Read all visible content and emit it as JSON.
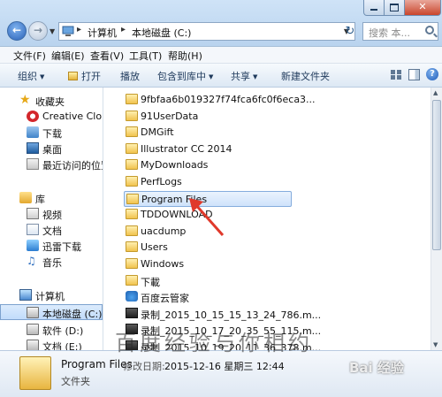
{
  "address": {
    "crumbs": [
      "计算机",
      "本地磁盘 (C:)"
    ],
    "separator": "▸"
  },
  "search": {
    "placeholder": "搜索 本..."
  },
  "menu": [
    "文件(F)",
    "编辑(E)",
    "查看(V)",
    "工具(T)",
    "帮助(H)"
  ],
  "commands": {
    "organize": "组织",
    "open": "打开",
    "play": "播放",
    "include": "包含到库中",
    "share": "共享",
    "new_folder": "新建文件夹"
  },
  "nav": {
    "favorites": "收藏夹",
    "creative_cloud": "Creative Cloud",
    "downloads": "下载",
    "desktop": "桌面",
    "recent": "最近访问的位置",
    "libraries": "库",
    "videos": "视频",
    "documents": "文档",
    "xunlei": "迅雷下载",
    "music": "音乐",
    "computer": "计算机",
    "drive_c": "本地磁盘 (C:)",
    "drive_d": "软件 (D:)",
    "drive_e": "文档 (E:)"
  },
  "files": [
    {
      "name": "9fbfaa6b019327f74fca6fc0f6eca3...",
      "icon": "folder-icon"
    },
    {
      "name": "91UserData",
      "icon": "folder-icon"
    },
    {
      "name": "DMGift",
      "icon": "folder-icon"
    },
    {
      "name": "Illustrator CC 2014",
      "icon": "folder-icon"
    },
    {
      "name": "MyDownloads",
      "icon": "folder-icon"
    },
    {
      "name": "PerfLogs",
      "icon": "folder-icon"
    },
    {
      "name": "Program Files",
      "icon": "folder-icon"
    },
    {
      "name": "TDDOWNLOAD",
      "icon": "folder-icon"
    },
    {
      "name": "uacdump",
      "icon": "folder-icon"
    },
    {
      "name": "Users",
      "icon": "folder-icon"
    },
    {
      "name": "Windows",
      "icon": "folder-icon"
    },
    {
      "name": "下載",
      "icon": "folder-icon"
    },
    {
      "name": "百度云管家",
      "icon": "cloud-icon"
    },
    {
      "name": "录制_2015_10_15_15_13_24_786.m...",
      "icon": "video-file-icon"
    },
    {
      "name": "录制_2015_10_17_20_35_55_115.m...",
      "icon": "video-file-icon"
    },
    {
      "name": "录制_2015_10_19_20_11_36_378.m...",
      "icon": "video-file-icon"
    }
  ],
  "selected_file": "Program Files",
  "details": {
    "name": "Program Files",
    "modified_label": "修改日期:",
    "modified_value": "2015-12-16 星期三 12:44",
    "type": "文件夹"
  },
  "watermark": "百度经验与你相约",
  "watermark_logo": "Bai 经验",
  "colors": {
    "accent": "#3f83c9",
    "selection": "#cfe3fb",
    "arrow": "#e0392b"
  }
}
